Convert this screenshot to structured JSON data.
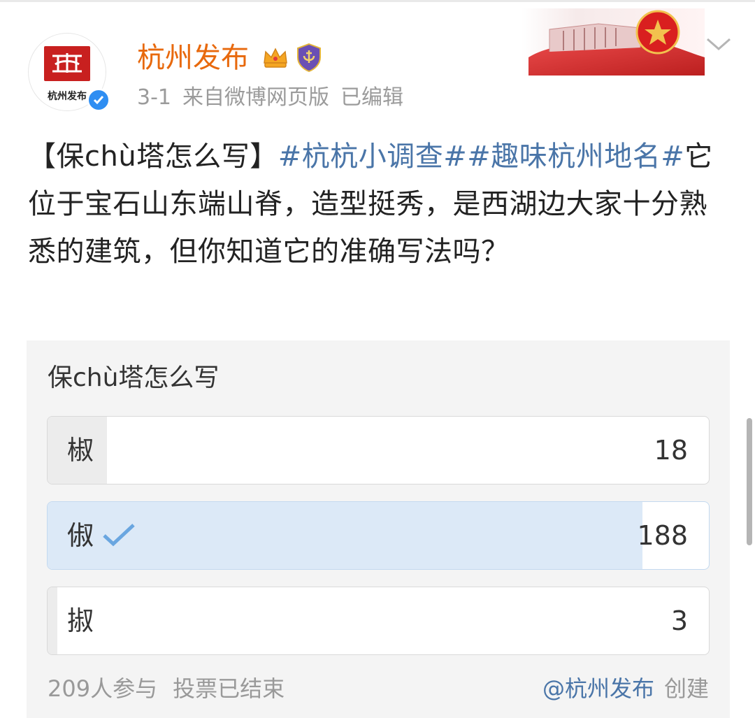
{
  "header": {
    "avatar_text": "杭州发布",
    "username": "杭州发布",
    "meta": {
      "time": "3-1",
      "source": "来自微博网页版",
      "edited": "已编辑"
    }
  },
  "post": {
    "prefix": "【保chù塔怎么写】",
    "tag1": "#杭杭小调查#",
    "tag2": "#趣味杭州地名#",
    "body": "它位于宝石山东端山脊，造型挺秀，是西湖边大家十分熟悉的建筑，但你知道它的准确写法吗？"
  },
  "poll": {
    "title": "保chù塔怎么写",
    "options": [
      {
        "label": "椒",
        "count": "18",
        "share": 0.09,
        "selected": false
      },
      {
        "label": "俶",
        "count": "188",
        "share": 0.9,
        "selected": true
      },
      {
        "label": "掓",
        "count": "3",
        "share": 0.015,
        "selected": false
      }
    ],
    "participants": "209人参与",
    "status": "投票已结束",
    "creator_link": "@杭州发布",
    "creator_suffix": "创建"
  },
  "colors": {
    "username": "#e8690d",
    "link": "#4a75a8",
    "selected_fill": "#dce9f7",
    "verified": "#2f8ef2"
  },
  "icons": [
    "verified-icon",
    "crown-badge-icon",
    "shield-badge-icon",
    "chevron-down-icon",
    "checkmark-icon"
  ]
}
